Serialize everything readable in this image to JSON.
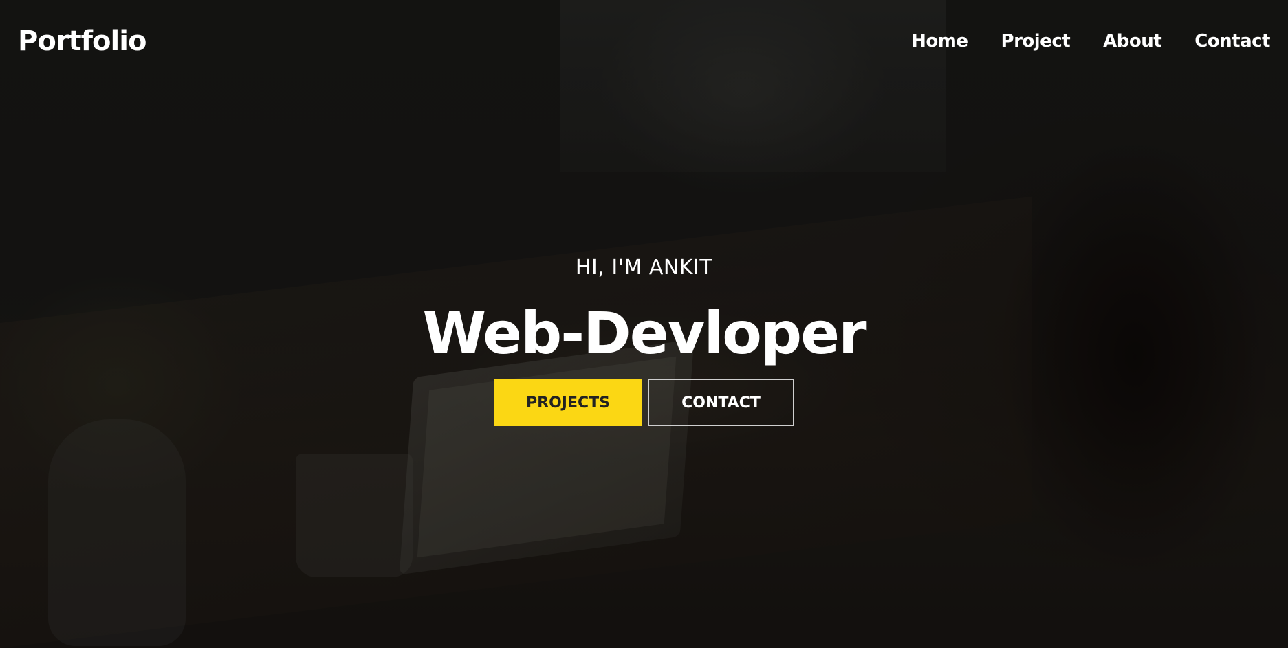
{
  "header": {
    "logo": "Portfolio",
    "nav": [
      {
        "label": "Home"
      },
      {
        "label": "Project"
      },
      {
        "label": "About"
      },
      {
        "label": "Contact"
      }
    ]
  },
  "hero": {
    "greeting": "HI, I'M ANKIT",
    "title": "Web-Devloper",
    "buttons": {
      "primary_label": "PROJECTS",
      "secondary_label": "CONTACT"
    },
    "background_image": "photo-person-working-on-laptop-at-desk"
  },
  "colors": {
    "accent": "#fbd714",
    "text": "#ffffff",
    "overlay": "rgba(0,0,0,0.55)"
  }
}
